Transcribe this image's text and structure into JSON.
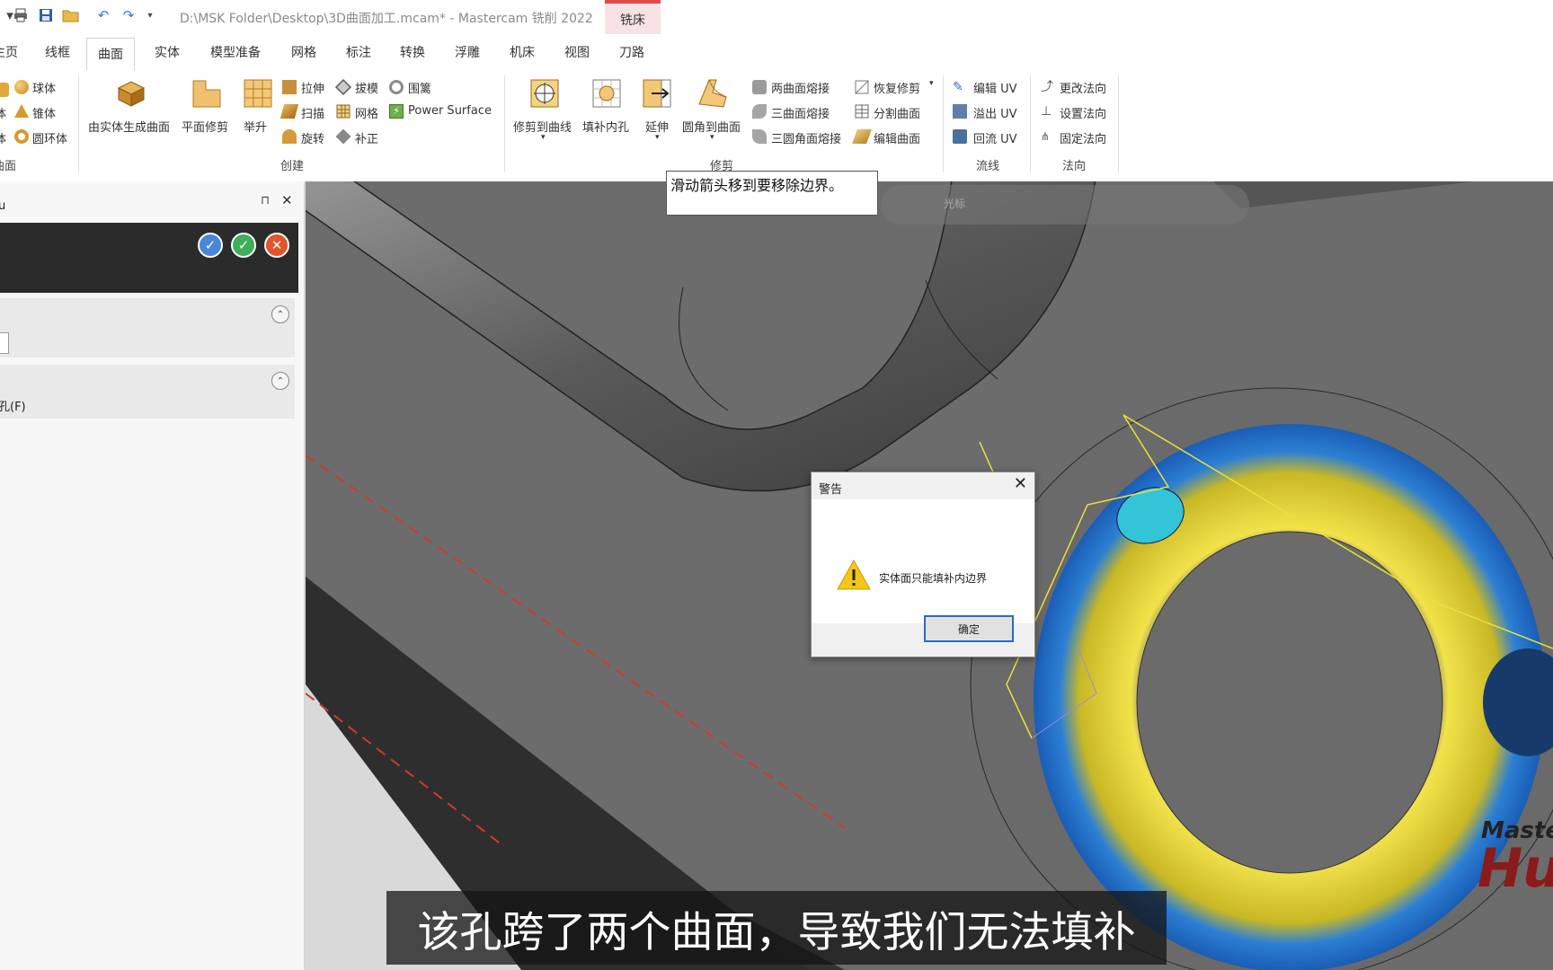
{
  "window": {
    "title": "D:\\MSK Folder\\Desktop\\3D曲面加工.mcam* - Mastercam 铣削 2022",
    "context_tab": "铣床"
  },
  "menu_tabs": [
    "主页",
    "线框",
    "曲面",
    "实体",
    "模型准备",
    "网格",
    "标注",
    "转换",
    "浮雕",
    "机床",
    "视图",
    "刀路"
  ],
  "active_tab": "曲面",
  "ribbon": {
    "basic_surfaces": {
      "items": [
        "球体",
        "锥体",
        "圆环体"
      ],
      "partial": [
        "体",
        "体"
      ],
      "group": "曲面"
    },
    "create": {
      "large": [
        "由实体生成曲面",
        "平面修剪",
        "举升"
      ],
      "small": [
        "拉伸",
        "扫描",
        "旋转",
        "拔模",
        "网格",
        "补正",
        "围篱",
        "Power Surface"
      ],
      "group": "创建"
    },
    "trim": {
      "large": [
        "修剪到曲线",
        "填补内孔",
        "延伸",
        "圆角到曲面"
      ],
      "small": [
        "两曲面熔接",
        "三曲面熔接",
        "三圆角面熔接",
        "恢复修剪",
        "分割曲面",
        "编辑曲面"
      ],
      "group": "修剪"
    },
    "flowline": {
      "items": [
        "编辑 UV",
        "溢出 UV",
        "回流 UV"
      ],
      "group": "流线"
    },
    "normal": {
      "items": [
        "更改法向",
        "设置法向",
        "固定法向"
      ],
      "group": "法向"
    }
  },
  "panel": {
    "header_char": "u",
    "pin": "⊓",
    "close": "✕",
    "option_text": "孔(F)"
  },
  "viewport": {
    "tooltip": "滑动箭头移到要移除边界。",
    "toolbar_label": "光标",
    "logo_text1": "Master",
    "logo_text2": "Hu"
  },
  "dialog": {
    "title": "警告",
    "message": "实体面只能填补内边界",
    "ok": "确定"
  },
  "subtitle": "该孔跨了两个曲面，导致我们无法填补"
}
